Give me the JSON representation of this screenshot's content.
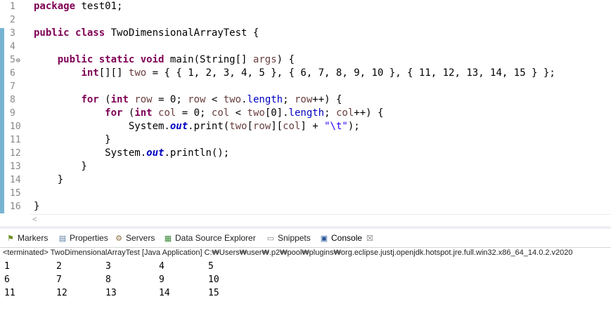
{
  "editor": {
    "lines": [
      {
        "n": "1",
        "segments": [
          {
            "t": "package",
            "c": "kw"
          },
          {
            "t": " test01;",
            "c": ""
          }
        ]
      },
      {
        "n": "2",
        "segments": []
      },
      {
        "n": "3",
        "segments": [
          {
            "t": "public",
            "c": "kw"
          },
          {
            "t": " ",
            "c": ""
          },
          {
            "t": "class",
            "c": "kw"
          },
          {
            "t": " TwoDimensionalArrayTest {",
            "c": ""
          }
        ]
      },
      {
        "n": "4",
        "segments": []
      },
      {
        "n": "5",
        "fold": "⊖",
        "segments": [
          {
            "t": "    ",
            "c": ""
          },
          {
            "t": "public",
            "c": "kw"
          },
          {
            "t": " ",
            "c": ""
          },
          {
            "t": "static",
            "c": "kw"
          },
          {
            "t": " ",
            "c": ""
          },
          {
            "t": "void",
            "c": "kw"
          },
          {
            "t": " main(String[] ",
            "c": ""
          },
          {
            "t": "args",
            "c": "var"
          },
          {
            "t": ") {",
            "c": ""
          }
        ]
      },
      {
        "n": "6",
        "segments": [
          {
            "t": "        ",
            "c": ""
          },
          {
            "t": "int",
            "c": "kw"
          },
          {
            "t": "[][] ",
            "c": ""
          },
          {
            "t": "two",
            "c": "var"
          },
          {
            "t": " = { { 1, 2, 3, 4, 5 }, { 6, 7, 8, 9, 10 }, { 11, 12, 13, 14, 15 } };",
            "c": ""
          }
        ]
      },
      {
        "n": "7",
        "segments": []
      },
      {
        "n": "8",
        "segments": [
          {
            "t": "        ",
            "c": ""
          },
          {
            "t": "for",
            "c": "kw"
          },
          {
            "t": " (",
            "c": ""
          },
          {
            "t": "int",
            "c": "kw"
          },
          {
            "t": " ",
            "c": ""
          },
          {
            "t": "row",
            "c": "var"
          },
          {
            "t": " = 0; ",
            "c": ""
          },
          {
            "t": "row",
            "c": "var"
          },
          {
            "t": " < ",
            "c": ""
          },
          {
            "t": "two",
            "c": "var"
          },
          {
            "t": ".",
            "c": ""
          },
          {
            "t": "length",
            "c": "fldn"
          },
          {
            "t": "; ",
            "c": ""
          },
          {
            "t": "row",
            "c": "var"
          },
          {
            "t": "++) {",
            "c": ""
          }
        ]
      },
      {
        "n": "9",
        "segments": [
          {
            "t": "            ",
            "c": ""
          },
          {
            "t": "for",
            "c": "kw"
          },
          {
            "t": " (",
            "c": ""
          },
          {
            "t": "int",
            "c": "kw"
          },
          {
            "t": " ",
            "c": ""
          },
          {
            "t": "col",
            "c": "var"
          },
          {
            "t": " = 0; ",
            "c": ""
          },
          {
            "t": "col",
            "c": "var"
          },
          {
            "t": " < ",
            "c": ""
          },
          {
            "t": "two",
            "c": "var"
          },
          {
            "t": "[0].",
            "c": ""
          },
          {
            "t": "length",
            "c": "fldn"
          },
          {
            "t": "; ",
            "c": ""
          },
          {
            "t": "col",
            "c": "var"
          },
          {
            "t": "++) {",
            "c": ""
          }
        ]
      },
      {
        "n": "10",
        "segments": [
          {
            "t": "                System.",
            "c": ""
          },
          {
            "t": "out",
            "c": "fld"
          },
          {
            "t": ".print(",
            "c": ""
          },
          {
            "t": "two",
            "c": "var"
          },
          {
            "t": "[",
            "c": ""
          },
          {
            "t": "row",
            "c": "var"
          },
          {
            "t": "][",
            "c": ""
          },
          {
            "t": "col",
            "c": "var"
          },
          {
            "t": "] + ",
            "c": ""
          },
          {
            "t": "\"\\t\"",
            "c": "str"
          },
          {
            "t": ");",
            "c": ""
          }
        ]
      },
      {
        "n": "11",
        "segments": [
          {
            "t": "            }",
            "c": ""
          }
        ]
      },
      {
        "n": "12",
        "segments": [
          {
            "t": "            System.",
            "c": ""
          },
          {
            "t": "out",
            "c": "fld"
          },
          {
            "t": ".println();",
            "c": ""
          }
        ]
      },
      {
        "n": "13",
        "segments": [
          {
            "t": "        }",
            "c": ""
          }
        ]
      },
      {
        "n": "14",
        "segments": [
          {
            "t": "    }",
            "c": ""
          }
        ]
      },
      {
        "n": "15",
        "segments": []
      },
      {
        "n": "16",
        "segments": [
          {
            "t": "}",
            "c": ""
          }
        ]
      }
    ]
  },
  "scroll": {
    "left_arrow": "<"
  },
  "tabs": [
    {
      "key": "markers",
      "label": "Markers",
      "icon": "markers-icon",
      "glyph": "⚑",
      "color": "#6b8e23"
    },
    {
      "key": "properties",
      "label": "Properties",
      "icon": "properties-icon",
      "glyph": "▤",
      "color": "#5b7fa6"
    },
    {
      "key": "servers",
      "label": "Servers",
      "icon": "servers-icon",
      "glyph": "⚙",
      "color": "#8a6d3b"
    },
    {
      "key": "data-source-explorer",
      "label": "Data Source Explorer",
      "icon": "data-source-icon",
      "glyph": "▦",
      "color": "#3d8b3d"
    },
    {
      "key": "snippets",
      "label": "Snippets",
      "icon": "snippets-icon",
      "glyph": "▭",
      "color": "#777777"
    },
    {
      "key": "console",
      "label": "Console",
      "icon": "console-icon",
      "glyph": "▣",
      "color": "#2b5797",
      "active": true,
      "close": "☒"
    }
  ],
  "console": {
    "status": "<terminated> TwoDimensionalArrayTest [Java Application] C:₩Users₩user₩.p2₩pool₩plugins₩org.eclipse.justj.openjdk.hotspot.jre.full.win32.x86_64_14.0.2.v2020",
    "rows": [
      [
        "1",
        "2",
        "3",
        "4",
        "5"
      ],
      [
        "6",
        "7",
        "8",
        "9",
        "10"
      ],
      [
        "11",
        "12",
        "13",
        "14",
        "15"
      ]
    ]
  },
  "colors": {
    "keyword": "#7f0055",
    "variable": "#6a3e3e",
    "field": "#0000c0",
    "string": "#2a00ff",
    "change_ruler": "#78b4d2"
  }
}
